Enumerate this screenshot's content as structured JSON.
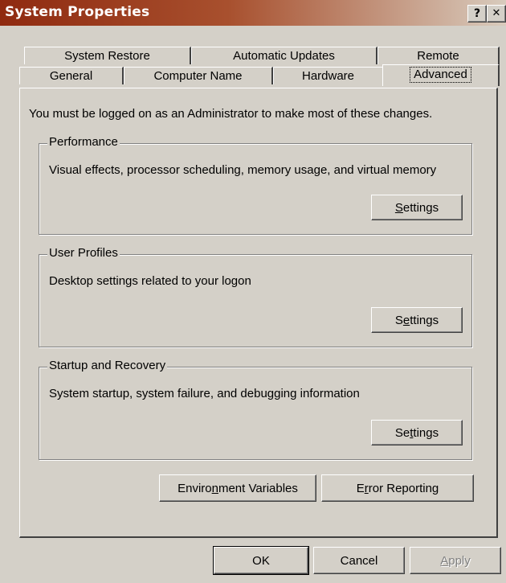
{
  "window": {
    "title": "System Properties",
    "help_label": "?",
    "close_label": "✕"
  },
  "tabs": {
    "row1": [
      "System Restore",
      "Automatic Updates",
      "Remote"
    ],
    "row2": [
      "General",
      "Computer Name",
      "Hardware",
      "Advanced"
    ],
    "active": "Advanced"
  },
  "panel": {
    "info": "You must be logged on as an Administrator to make most of these changes.",
    "performance": {
      "label": "Performance",
      "desc": "Visual effects, processor scheduling, memory usage, and virtual memory",
      "button_pre": "",
      "button_key": "S",
      "button_post": "ettings"
    },
    "user_profiles": {
      "label": "User Profiles",
      "desc": "Desktop settings related to your logon",
      "button_pre": "S",
      "button_key": "e",
      "button_post": "ttings"
    },
    "startup": {
      "label": "Startup and Recovery",
      "desc": "System startup, system failure, and debugging information",
      "button_pre": "Se",
      "button_key": "t",
      "button_post": "tings"
    },
    "env_button": {
      "pre": "Enviro",
      "key": "n",
      "post": "ment Variables"
    },
    "error_button": {
      "pre": "E",
      "key": "r",
      "post": "ror Reporting"
    }
  },
  "footer": {
    "ok_label": "OK",
    "cancel_label": "Cancel",
    "apply_pre": "",
    "apply_key": "A",
    "apply_post": "pply"
  }
}
